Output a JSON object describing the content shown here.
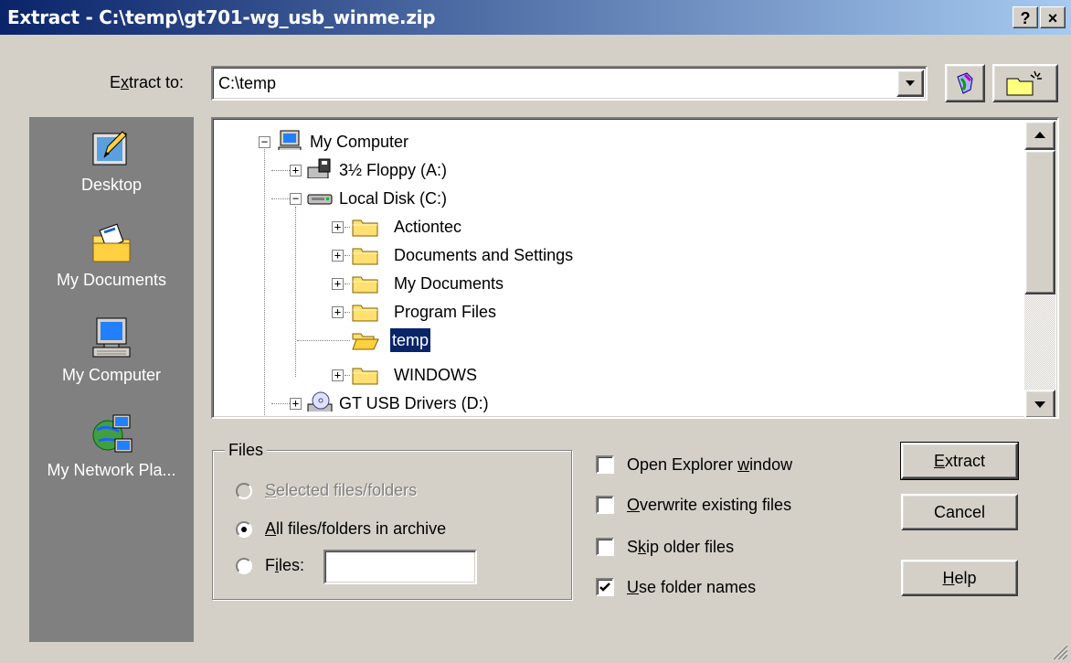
{
  "window": {
    "title": "Extract - C:\\temp\\gt701-wg_usb_winme.zip",
    "help_btn": "?",
    "close_btn": "×"
  },
  "extract_to": {
    "label_pre": "E",
    "label_ul": "x",
    "label_post": "tract to:",
    "value": "C:\\temp"
  },
  "places": [
    {
      "label": "Desktop",
      "icon": "desktop-icon"
    },
    {
      "label": "My Documents",
      "icon": "my-documents-icon"
    },
    {
      "label": "My Computer",
      "icon": "my-computer-icon"
    },
    {
      "label": "My Network Pla...",
      "icon": "network-places-icon"
    }
  ],
  "tree": [
    {
      "label": "My Computer",
      "level": 0,
      "icon": "computer-icon",
      "toggle": "−"
    },
    {
      "label": "3½ Floppy (A:)",
      "level": 1,
      "icon": "floppy-icon",
      "toggle": "+"
    },
    {
      "label": "Local Disk (C:)",
      "level": 1,
      "icon": "hard-disk-icon",
      "toggle": "−"
    },
    {
      "label": "Actiontec",
      "level": 2,
      "icon": "folder-icon",
      "toggle": "+"
    },
    {
      "label": "Documents and Settings",
      "level": 2,
      "icon": "folder-icon",
      "toggle": "+"
    },
    {
      "label": "My Documents",
      "level": 2,
      "icon": "folder-icon",
      "toggle": "+"
    },
    {
      "label": "Program Files",
      "level": 2,
      "icon": "folder-icon",
      "toggle": "+"
    },
    {
      "label": "temp",
      "level": 2,
      "icon": "open-folder-icon",
      "toggle": "",
      "selected": true
    },
    {
      "label": "WINDOWS",
      "level": 2,
      "icon": "folder-icon",
      "toggle": "+"
    },
    {
      "label": "GT USB Drivers (D:)",
      "level": 1,
      "icon": "cd-drive-icon",
      "toggle": "+"
    }
  ],
  "files_group": {
    "title": "Files",
    "opt_selected": {
      "ul": "S",
      "rest": "elected files/folders",
      "enabled": false,
      "checked": false
    },
    "opt_all": {
      "ul": "A",
      "rest": "ll files/folders in archive",
      "enabled": true,
      "checked": true
    },
    "opt_files": {
      "pre": "F",
      "ul": "i",
      "rest": "les:",
      "enabled": true,
      "checked": false
    },
    "files_value": ""
  },
  "options": {
    "open_explorer": {
      "pre": "Open Explorer ",
      "ul": "w",
      "rest": "indow",
      "checked": false
    },
    "overwrite": {
      "pre": "",
      "ul": "O",
      "rest": "verwrite existing files",
      "checked": false
    },
    "skip_older": {
      "pre": "S",
      "ul": "k",
      "rest": "ip older files",
      "checked": false
    },
    "use_folder_names": {
      "pre": "",
      "ul": "U",
      "rest": "se folder names",
      "checked": true
    }
  },
  "buttons": {
    "extract": {
      "ul": "E",
      "rest": "xtract"
    },
    "cancel": {
      "label": "Cancel"
    },
    "help": {
      "ul": "H",
      "rest": "elp"
    }
  }
}
